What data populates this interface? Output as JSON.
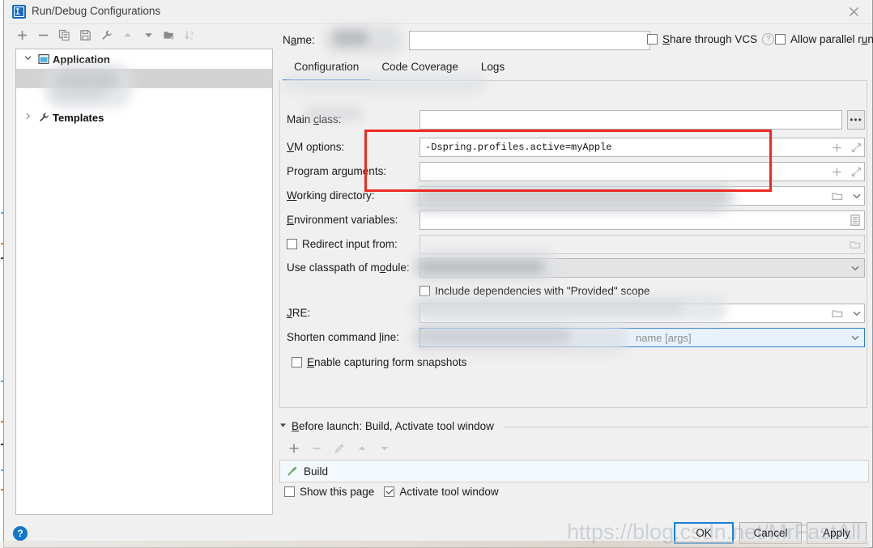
{
  "window": {
    "title": "Run/Debug Configurations",
    "logo_icon": "intellij-idea-logo-icon",
    "close_icon": "close-icon"
  },
  "left_panel": {
    "toolbar": [
      {
        "name": "add-configuration-button",
        "icon": "plus-icon",
        "enabled": true
      },
      {
        "name": "remove-configuration-button",
        "icon": "minus-icon",
        "enabled": true
      },
      {
        "name": "copy-configuration-button",
        "icon": "copy-icon",
        "enabled": true
      },
      {
        "name": "save-configuration-button",
        "icon": "save-icon",
        "enabled": true
      },
      {
        "name": "edit-templates-button",
        "icon": "wrench-icon",
        "enabled": true
      },
      {
        "name": "move-up-button",
        "icon": "arrow-up-icon",
        "enabled": false
      },
      {
        "name": "move-down-button",
        "icon": "arrow-down-icon",
        "enabled": true
      },
      {
        "name": "new-folder-button",
        "icon": "folder-add-icon",
        "enabled": true
      },
      {
        "name": "sort-alphabetically-button",
        "icon": "sort-az-icon",
        "enabled": false
      }
    ],
    "tree": [
      {
        "label": "Application",
        "icon": "application-node-icon",
        "expanded": true,
        "arrow": "chevron-down-icon",
        "selected": false
      },
      {
        "label": "",
        "icon": "",
        "expanded": false,
        "arrow": "",
        "selected": true
      },
      {
        "label": "Templates",
        "icon": "wrench-icon",
        "expanded": false,
        "arrow": "chevron-right-icon",
        "selected": false
      }
    ]
  },
  "header": {
    "name_label": "Name:",
    "name_value": "",
    "name_placeholder": "",
    "share_through_vcs": {
      "label": "Share through VCS",
      "checked": false
    },
    "share_help_icon": "question-mark-icon",
    "allow_parallel_run": {
      "label": "Allow parallel run",
      "checked": false
    }
  },
  "tabs": [
    {
      "label": "Configuration",
      "active": true
    },
    {
      "label": "Code Coverage",
      "active": false
    },
    {
      "label": "Logs",
      "active": false
    }
  ],
  "form": {
    "rows": [
      {
        "name": "main-class",
        "label": "Main class:",
        "value": "",
        "kind": "text-with-browse",
        "adornments": [
          "ellipsis-button"
        ]
      },
      {
        "name": "vm-options",
        "label": "VM options:",
        "value": "-Dspring.profiles.active=myApple",
        "kind": "text-with-expand",
        "adornments": [
          "plus-icon",
          "expand-icon"
        ]
      },
      {
        "name": "program-arguments",
        "label": "Program arguments:",
        "value": "",
        "kind": "text-with-expand",
        "adornments": [
          "plus-icon",
          "expand-icon"
        ]
      },
      {
        "name": "working-directory",
        "label": "Working directory:",
        "value": "",
        "kind": "text-with-folder-combo",
        "adornments": [
          "folder-icon",
          "chevron-down-icon"
        ]
      },
      {
        "name": "environment-variables",
        "label": "Environment variables:",
        "value": "",
        "kind": "text-with-list",
        "adornments": [
          "list-edit-icon"
        ]
      },
      {
        "name": "redirect-input-from",
        "label": "Redirect input from:",
        "value": "",
        "kind": "checkbox-text-folder",
        "checked": false,
        "disabled": true,
        "adornments": [
          "folder-icon"
        ]
      },
      {
        "name": "use-classpath-of-module",
        "label": "Use classpath of module:",
        "value": "",
        "kind": "combo",
        "adornments": [
          "chevron-down-icon"
        ]
      },
      {
        "name": "include-provided-scope",
        "label": "Include dependencies with \"Provided\" scope",
        "kind": "checkbox",
        "checked": false
      },
      {
        "name": "jre",
        "label": "JRE:",
        "value": "",
        "kind": "text-with-folder-combo",
        "adornments": [
          "folder-icon",
          "chevron-down-icon"
        ]
      },
      {
        "name": "shorten-command-line",
        "label": "Shorten command line:",
        "value": "name [args]",
        "value_is_hint": true,
        "kind": "combo",
        "focused": true,
        "adornments": [
          "chevron-down-icon"
        ]
      },
      {
        "name": "enable-capturing-form-snapshots",
        "label": "Enable capturing form snapshots",
        "kind": "checkbox",
        "checked": false
      }
    ]
  },
  "before_launch": {
    "collapse_icon": "triangle-down-icon",
    "title": "Before launch: Build, Activate tool window",
    "toolbar": [
      {
        "name": "add-task-button",
        "icon": "plus-icon",
        "enabled": true
      },
      {
        "name": "remove-task-button",
        "icon": "minus-icon",
        "enabled": false
      },
      {
        "name": "edit-task-button",
        "icon": "pencil-icon",
        "enabled": false
      },
      {
        "name": "move-task-up-button",
        "icon": "arrow-up-icon",
        "enabled": false
      },
      {
        "name": "move-task-down-button",
        "icon": "arrow-down-icon",
        "enabled": false
      }
    ],
    "items": [
      {
        "label": "Build",
        "icon": "build-hammer-icon"
      }
    ],
    "show_this_page": {
      "label": "Show this page",
      "checked": false
    },
    "activate_tool_window": {
      "label": "Activate tool window",
      "checked": true
    }
  },
  "footer": {
    "help_icon": "help-circle-icon",
    "buttons": [
      {
        "label": "OK",
        "primary": true
      },
      {
        "label": "Cancel",
        "primary": false
      },
      {
        "label": "Apply",
        "primary": false
      }
    ]
  },
  "overlay": {
    "annotation_rect_color": "#ee2a24",
    "watermark_text": "https://blog.csdn.net/MrFastAll"
  },
  "colors": {
    "accent": "#2a7bd4",
    "dialog_bg": "#f0f0f0",
    "field_bg": "#ffffff",
    "selection": "#d3d3d3",
    "list_bg": "#f3f9fd",
    "annotation": "#ee2a24"
  }
}
